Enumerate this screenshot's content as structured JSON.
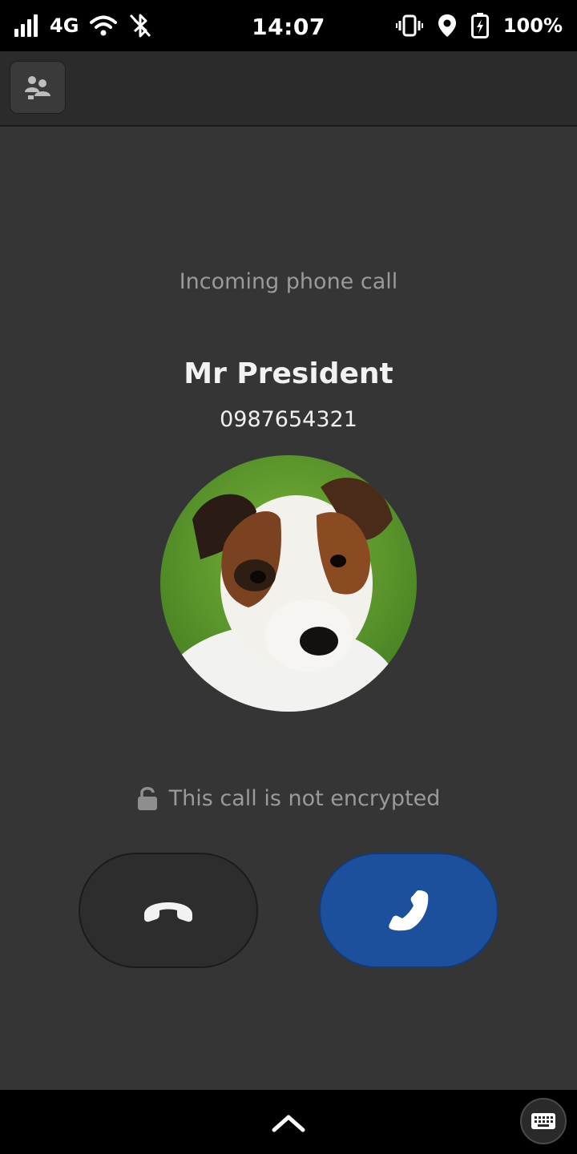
{
  "status_bar": {
    "network_type": "4G",
    "time": "14:07",
    "battery_percent": "100%",
    "icons": [
      "signal-icon",
      "wifi-icon",
      "bluetooth-disabled-icon",
      "vibrate-icon",
      "location-icon",
      "battery-charging-icon"
    ]
  },
  "header": {
    "contacts_button_icon": "contacts-icon"
  },
  "call": {
    "status": "Incoming phone call",
    "caller_name": "Mr President",
    "caller_number": "0987654321",
    "encryption_text": "This call is not encrypted",
    "avatar_description_icon": "caller-avatar"
  },
  "actions": {
    "decline_icon": "hangup-icon",
    "accept_icon": "phone-icon"
  },
  "bottom_bar": {
    "home_icon": "chevron-up-icon",
    "keyboard_icon": "keyboard-icon"
  },
  "colors": {
    "background": "#353535",
    "accept": "#1c4f9c",
    "decline": "#2d2d2d",
    "muted_text": "#9a9a9a"
  }
}
